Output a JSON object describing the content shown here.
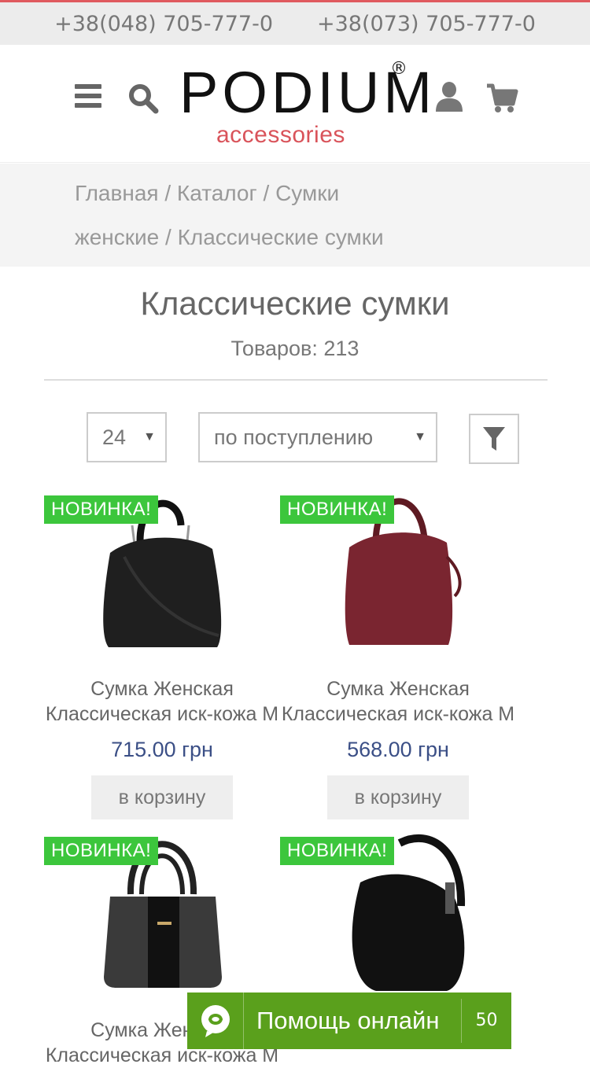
{
  "topbar": {
    "phone1": "+38(048) 705-777-0",
    "phone2": "+38(073) 705-777-0",
    "accent_color": "#e05a5f"
  },
  "header": {
    "logo_main": "PODIUM",
    "logo_reg": "®",
    "logo_sub": "accessories",
    "icons": [
      "menu-icon",
      "search-icon",
      "user-icon",
      "cart-icon"
    ]
  },
  "breadcrumb": {
    "items": [
      "Главная",
      "Каталог",
      "Сумки женские",
      "Классические сумки"
    ],
    "separator": "/"
  },
  "page": {
    "title": "Классические сумки",
    "count_label": "Товаров: 213"
  },
  "filters": {
    "per_page": "24",
    "sort": "по поступлению"
  },
  "products": [
    {
      "badge": "НОВИНКА!",
      "name": "Сумка Женская Классическая иск-кожа М",
      "price": "715.00 грн",
      "button": "в корзину",
      "color": "#1f1f1f"
    },
    {
      "badge": "НОВИНКА!",
      "name": "Сумка Женская Классическая иск-кожа М",
      "price": "568.00 грн",
      "button": "в корзину",
      "color": "#7a2530"
    },
    {
      "badge": "НОВИНКА!",
      "name": "Сумка Женская Классическая иск-кожа М",
      "price": "",
      "button": "",
      "color": "#2a2a2a"
    },
    {
      "badge": "НОВИНКА!",
      "name": "",
      "price": "",
      "button": "",
      "color": "#111111"
    }
  ],
  "help_widget": {
    "label": "Помощь онлайн",
    "count": "50",
    "color": "#5aa01c"
  }
}
